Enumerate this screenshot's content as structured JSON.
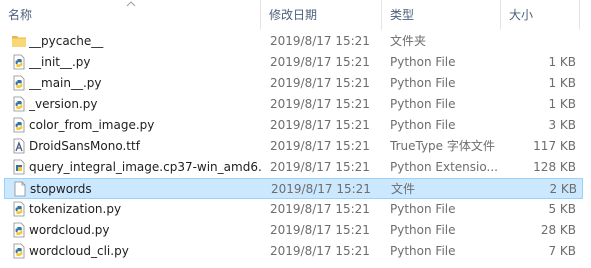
{
  "columns": {
    "name": "名称",
    "date": "修改日期",
    "type": "类型",
    "size": "大小"
  },
  "files": [
    {
      "name": "__pycache__",
      "date": "2019/8/17 15:21",
      "type": "文件夹",
      "size": "",
      "icon": "folder-icon"
    },
    {
      "name": "__init__.py",
      "date": "2019/8/17 15:21",
      "type": "Python File",
      "size": "1 KB",
      "icon": "python-file-icon"
    },
    {
      "name": "__main__.py",
      "date": "2019/8/17 15:21",
      "type": "Python File",
      "size": "1 KB",
      "icon": "python-file-icon"
    },
    {
      "name": "_version.py",
      "date": "2019/8/17 15:21",
      "type": "Python File",
      "size": "1 KB",
      "icon": "python-file-icon"
    },
    {
      "name": "color_from_image.py",
      "date": "2019/8/17 15:21",
      "type": "Python File",
      "size": "3 KB",
      "icon": "python-file-icon"
    },
    {
      "name": "DroidSansMono.ttf",
      "date": "2019/8/17 15:21",
      "type": "TrueType 字体文件",
      "size": "117 KB",
      "icon": "font-file-icon"
    },
    {
      "name": "query_integral_image.cp37-win_amd6...",
      "date": "2019/8/17 15:21",
      "type": "Python Extensio...",
      "size": "128 KB",
      "icon": "python-extension-icon"
    },
    {
      "name": "stopwords",
      "date": "2019/8/17 15:21",
      "type": "文件",
      "size": "2 KB",
      "icon": "blank-file-icon"
    },
    {
      "name": "tokenization.py",
      "date": "2019/8/17 15:21",
      "type": "Python File",
      "size": "5 KB",
      "icon": "python-file-icon"
    },
    {
      "name": "wordcloud.py",
      "date": "2019/8/17 15:21",
      "type": "Python File",
      "size": "28 KB",
      "icon": "python-file-icon"
    },
    {
      "name": "wordcloud_cli.py",
      "date": "2019/8/17 15:21",
      "type": "Python File",
      "size": "7 KB",
      "icon": "python-file-icon"
    }
  ],
  "selected_index": 7,
  "colors": {
    "selection_bg": "#cce8ff",
    "selection_border": "#99d1ff",
    "header_text": "#4c607a",
    "folder": "#f8d775"
  }
}
